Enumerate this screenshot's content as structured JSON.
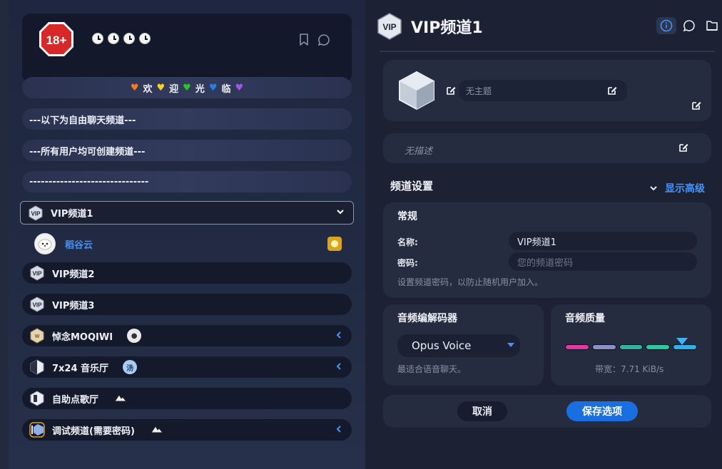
{
  "sidebar": {
    "server": {
      "logo_text": "18+"
    },
    "welcome": {
      "words": [
        "欢",
        "迎",
        "光",
        "临"
      ],
      "heart_colors": [
        "#f47c20",
        "#f7d21e",
        "#27c42a",
        "#2a7de8",
        "#9b59e0"
      ]
    },
    "banners": [
      "---以下为自由聊天频道---",
      "---所有用户均可创建频道---",
      "-------------------------------"
    ],
    "active_channel": "VIP频道1",
    "user": {
      "name": "稻谷云",
      "badge": "coin-badge"
    },
    "channels": [
      {
        "label": "VIP频道2"
      },
      {
        "label": "VIP频道3"
      },
      {
        "label": "悼念MOQIWI",
        "has_avatar": true
      },
      {
        "label": "7x24 音乐厅",
        "avatar_text": "汤"
      },
      {
        "label": "自助点歌厅",
        "has_avatar": true
      },
      {
        "label": "调试频道(需要密码)",
        "has_avatar": true
      }
    ]
  },
  "main": {
    "title": "VIP频道1",
    "header_icon": "VIP",
    "tools": [
      "info-icon",
      "chat-icon",
      "file-icon"
    ],
    "theme_placeholder": "无主题",
    "description_placeholder": "无描述",
    "settings_title": "频道设置",
    "advanced_label": "显示高级",
    "general": {
      "title": "常规",
      "name_label": "名称:",
      "name_value": "VIP频道1",
      "password_label": "密码:",
      "password_placeholder": "您的频道密码",
      "hint": "设置频道密码，以防止随机用户加入。"
    },
    "codec": {
      "title": "音频编解码器",
      "selected": "Opus Voice",
      "hint": "最适合语音聊天。"
    },
    "quality": {
      "title": "音频质量",
      "bandwidth": "带宽：7.71 KiB/s",
      "level": 5,
      "max_level": 5,
      "segment_colors": [
        "#e0399e",
        "#8f8fc7",
        "#2fb39e",
        "#2ac9a0",
        "#2fb0e8"
      ]
    },
    "actions": {
      "cancel": "取消",
      "save": "保存选项"
    }
  },
  "colors": {
    "accent": "#1a6fe0",
    "link": "#4a92f2",
    "panel": "#252c40"
  }
}
